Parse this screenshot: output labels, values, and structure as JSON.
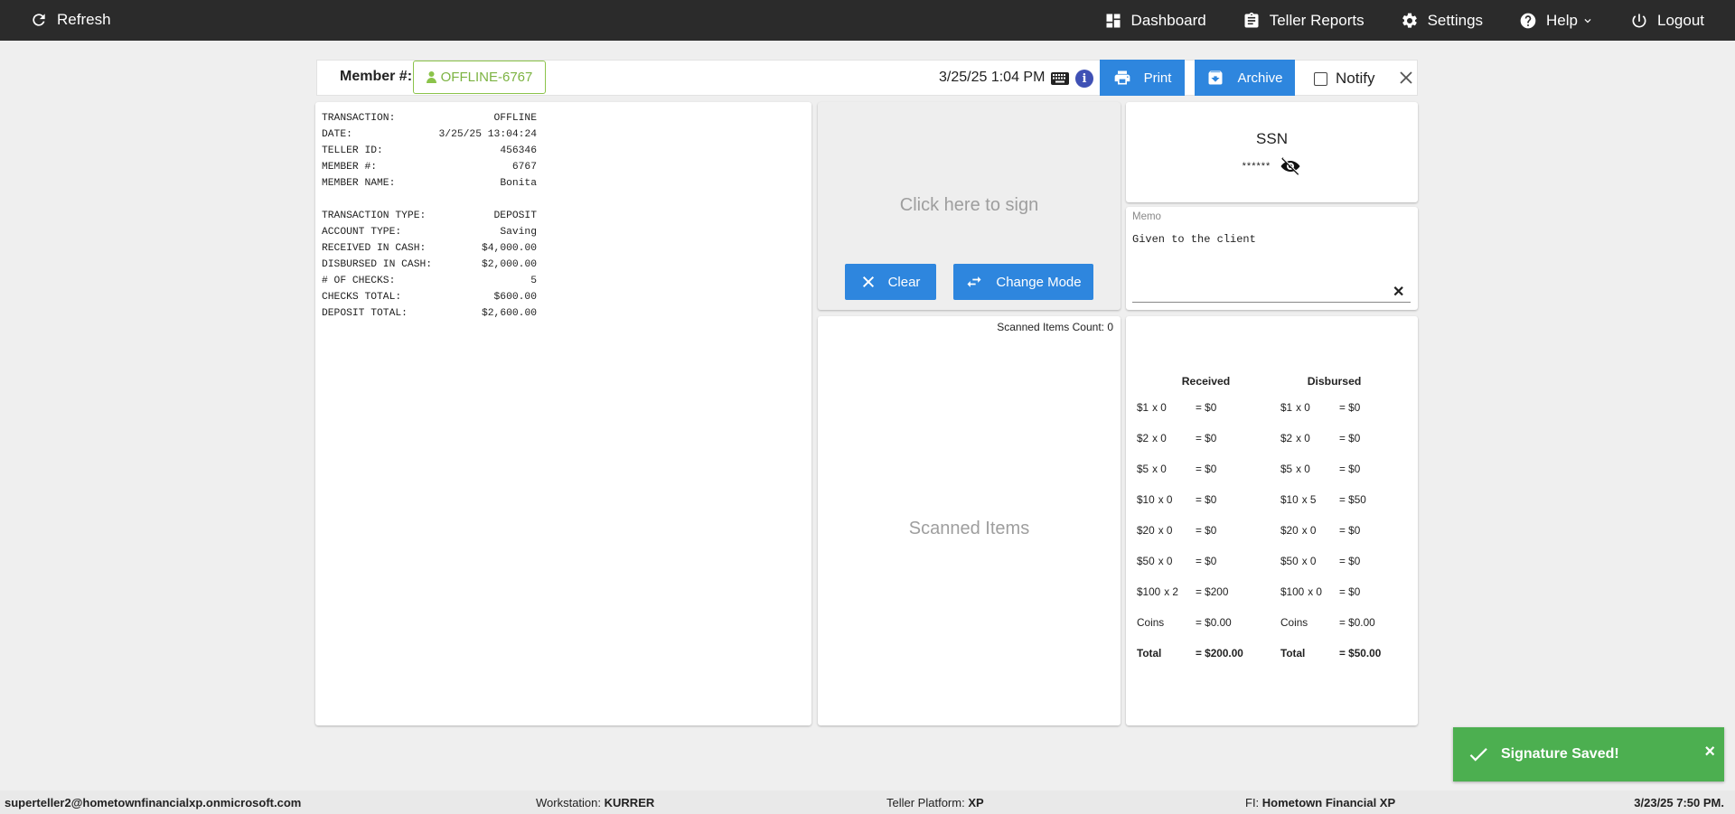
{
  "topbar": {
    "refresh_label": "Refresh",
    "nav": [
      {
        "label": "Dashboard",
        "icon": "dashboard-icon"
      },
      {
        "label": "Teller Reports",
        "icon": "clipboard-icon"
      },
      {
        "label": "Settings",
        "icon": "gear-icon"
      },
      {
        "label": "Help",
        "icon": "help-icon"
      },
      {
        "label": "Logout",
        "icon": "power-icon"
      }
    ]
  },
  "header": {
    "member_label": "Member #:",
    "member_value": "OFFLINE-6767",
    "datetime": "3/25/25 1:04 PM",
    "print_label": "Print",
    "archive_label": "Archive",
    "notify_label": "Notify",
    "notify_checked": false
  },
  "receipt": {
    "rows_top": [
      {
        "k": "TRANSACTION:",
        "v": "OFFLINE"
      },
      {
        "k": "DATE:",
        "v": "3/25/25 13:04:24"
      },
      {
        "k": "TELLER ID:",
        "v": "456346"
      },
      {
        "k": "MEMBER #:",
        "v": "6767"
      },
      {
        "k": "MEMBER NAME:",
        "v": "Bonita"
      }
    ],
    "rows_bottom": [
      {
        "k": "TRANSACTION TYPE:",
        "v": "DEPOSIT"
      },
      {
        "k": "ACCOUNT TYPE:",
        "v": "Saving"
      },
      {
        "k": "RECEIVED IN CASH:",
        "v": "$4,000.00"
      },
      {
        "k": "DISBURSED IN CASH:",
        "v": "$2,000.00"
      },
      {
        "k": "# OF CHECKS:",
        "v": "5"
      },
      {
        "k": "CHECKS TOTAL:",
        "v": "$600.00"
      },
      {
        "k": "DEPOSIT TOTAL:",
        "v": "$2,600.00"
      }
    ]
  },
  "signature": {
    "placeholder": "Click here to sign",
    "clear_label": "Clear",
    "mode_label": "Change Mode"
  },
  "ssn": {
    "title": "SSN",
    "masked": "******"
  },
  "memo": {
    "label": "Memo",
    "value": "Given to the client"
  },
  "scanned": {
    "count_label": "Scanned Items Count: 0",
    "placeholder": "Scanned Items"
  },
  "cash": {
    "received_header": "Received",
    "disbursed_header": "Disbursed",
    "rows": [
      {
        "r_den": "$1",
        "r_cnt": "x 0",
        "r_amt": "= $0",
        "d_den": "$1",
        "d_cnt": "x 0",
        "d_amt": "= $0"
      },
      {
        "r_den": "$2",
        "r_cnt": "x 0",
        "r_amt": "= $0",
        "d_den": "$2",
        "d_cnt": "x 0",
        "d_amt": "= $0"
      },
      {
        "r_den": "$5",
        "r_cnt": "x 0",
        "r_amt": "= $0",
        "d_den": "$5",
        "d_cnt": "x 0",
        "d_amt": "= $0"
      },
      {
        "r_den": "$10",
        "r_cnt": "x 0",
        "r_amt": "= $0",
        "d_den": "$10",
        "d_cnt": "x 5",
        "d_amt": "= $50"
      },
      {
        "r_den": "$20",
        "r_cnt": "x 0",
        "r_amt": "= $0",
        "d_den": "$20",
        "d_cnt": "x 0",
        "d_amt": "= $0"
      },
      {
        "r_den": "$50",
        "r_cnt": "x 0",
        "r_amt": "= $0",
        "d_den": "$50",
        "d_cnt": "x 0",
        "d_amt": "= $0"
      },
      {
        "r_den": "$100",
        "r_cnt": "x 2",
        "r_amt": "= $200",
        "d_den": "$100",
        "d_cnt": "x 0",
        "d_amt": "= $0"
      },
      {
        "r_den": "Coins",
        "r_cnt": "",
        "r_amt": "= $0.00",
        "d_den": "Coins",
        "d_cnt": "",
        "d_amt": "= $0.00"
      }
    ],
    "total": {
      "r_label": "Total",
      "r_amt": "= $200.00",
      "d_label": "Total",
      "d_amt": "= $50.00"
    }
  },
  "footer": {
    "user": "superteller2@hometownfinancialxp.onmicrosoft.com",
    "workstation_label": "Workstation:",
    "workstation_value": "KURRER",
    "platform_label": "Teller Platform:",
    "platform_value": "XP",
    "fi_label": "FI:",
    "fi_value": "Hometown Financial XP",
    "datetime": "3/23/25 7:50 PM."
  },
  "toast": {
    "message": "Signature Saved!"
  },
  "colors": {
    "topbar": "#2b2b2b",
    "primary_button": "#2e86de",
    "member_chip": "#8bc34a",
    "toast": "#4caf50"
  }
}
